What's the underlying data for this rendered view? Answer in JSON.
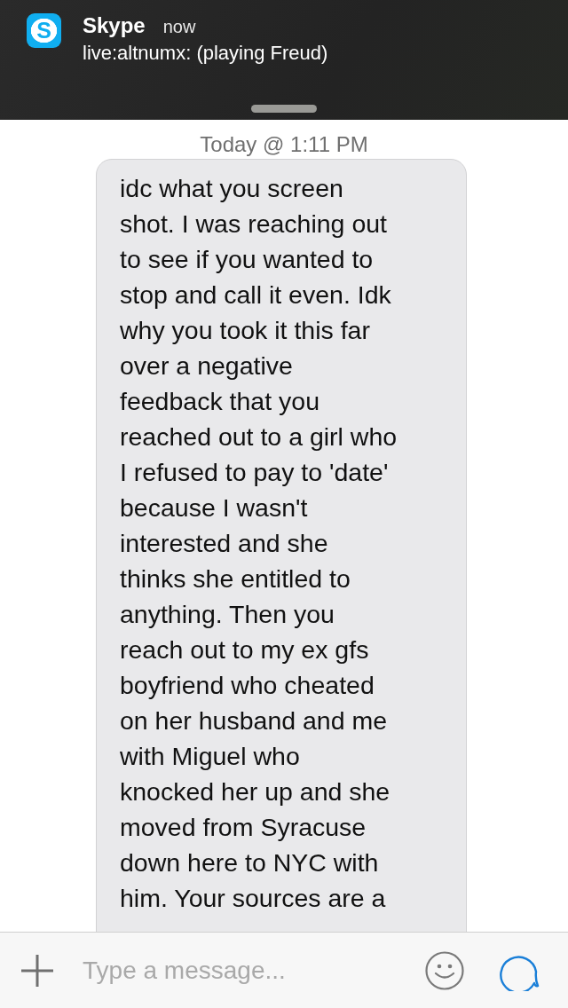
{
  "notification": {
    "app_icon_letter": "S",
    "app": "Skype",
    "time": "now",
    "message": "live:altnumx: (playing Freud)"
  },
  "timestamp": "Today @ 1:11 PM",
  "messages": [
    {
      "lines": [
        "idc what you screen",
        "shot. I was reaching out",
        "to see if you wanted to",
        "stop and call it even. Idk",
        "why you took it this far",
        "over a negative",
        "feedback that you",
        "reached out to a girl who",
        "I refused to pay to 'date'",
        "because I wasn't",
        "interested and she",
        "thinks she entitled to",
        "anything. Then you",
        "reach out to my ex gfs",
        "boyfriend who cheated",
        "on her husband and me",
        "with Miguel who",
        "knocked her up and she",
        "moved from Syracuse",
        "down here to NYC with",
        "him. Your sources are a"
      ]
    }
  ],
  "composer": {
    "placeholder": "Type a message..."
  }
}
